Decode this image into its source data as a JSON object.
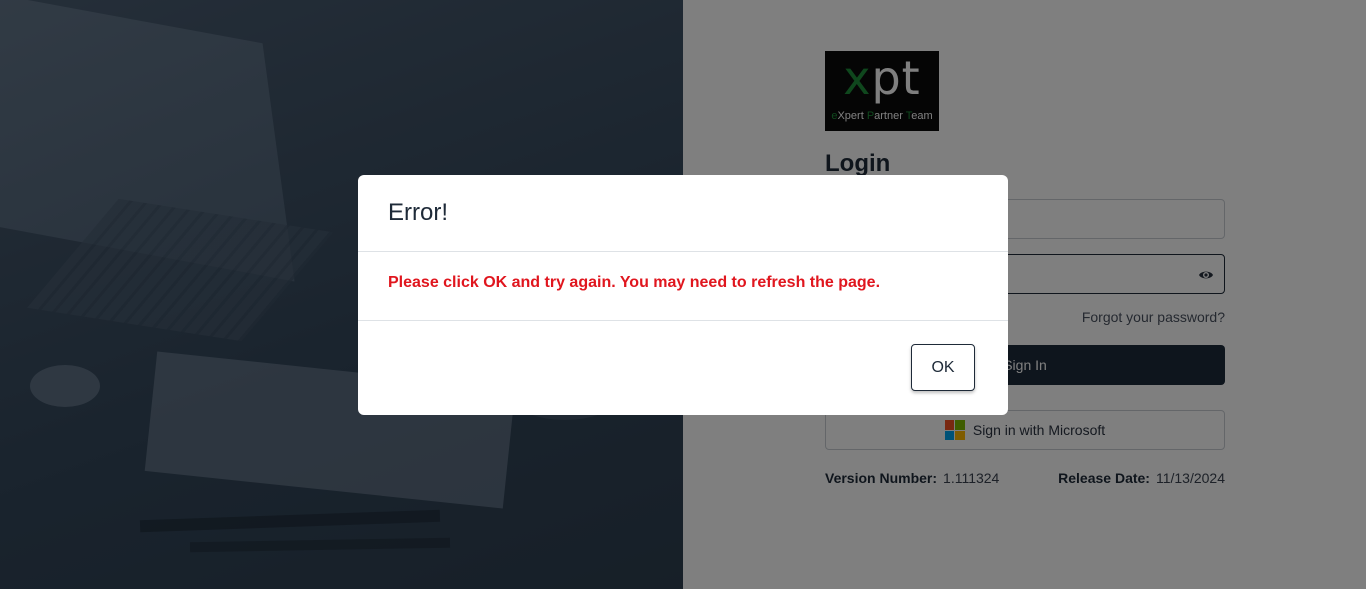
{
  "login": {
    "logo": {
      "mark_x": "x",
      "mark_rest": "pt",
      "tag_e": "e",
      "tag_x": "X",
      "tag_pert": "pert ",
      "tag_p": "P",
      "tag_artner": "artner ",
      "tag_t": "T",
      "tag_eam": "eam"
    },
    "title": "Login",
    "forgot_password": "Forgot your password?",
    "sign_in_label": "Sign In",
    "microsoft_label": "Sign in with Microsoft",
    "version_label": "Version Number:",
    "version_value": "1.111324",
    "release_label": "Release Date:",
    "release_value": "11/13/2024"
  },
  "modal": {
    "title": "Error!",
    "message": "Please click OK and try again. You may need to refresh the page.",
    "ok_label": "OK"
  },
  "icons": {
    "password_toggle": "eye-icon",
    "microsoft": "microsoft-logo-icon"
  },
  "colors": {
    "brand_dark": "#1c2a3a",
    "error_red": "#e0161e",
    "logo_green": "#1f8f3a",
    "ms_red": "#f25022",
    "ms_green": "#7fba00",
    "ms_blue": "#00a4ef",
    "ms_yellow": "#ffb900"
  }
}
